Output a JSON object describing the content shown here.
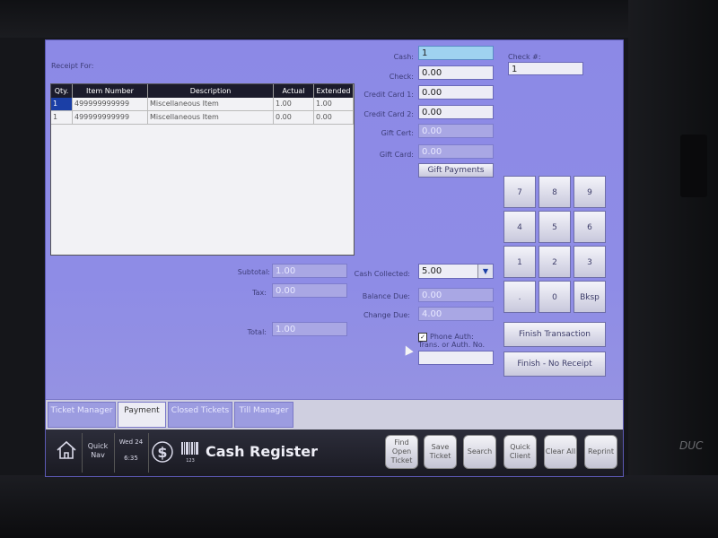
{
  "brand": "DUC",
  "receipt": {
    "label": "Receipt For:",
    "columns": [
      "Qty.",
      "Item Number",
      "Description",
      "Actual",
      "Extended"
    ],
    "rows": [
      [
        "1",
        "499999999999",
        "Miscellaneous Item",
        "1.00",
        "1.00"
      ],
      [
        "1",
        "499999999999",
        "Miscellaneous Item",
        "0.00",
        "0.00"
      ]
    ]
  },
  "totals": {
    "subtotal_label": "Subtotal:",
    "subtotal": "1.00",
    "tax_label": "Tax:",
    "tax": "0.00",
    "total_label": "Total:",
    "total": "1.00"
  },
  "payment": {
    "cash_label": "Cash:",
    "cash": "1",
    "check_label": "Check:",
    "check": "0.00",
    "credit1_label": "Credit Card 1:",
    "credit1": "0.00",
    "credit2_label": "Credit Card 2:",
    "credit2": "0.00",
    "gift_cert_label": "Gift Cert:",
    "gift_cert": "0.00",
    "gift_card_label": "Gift Card:",
    "gift_card": "0.00",
    "gift_payments_button": "Gift Payments",
    "check_num_label": "Check #:",
    "check_num": "1"
  },
  "summary": {
    "cash_collected_label": "Cash Collected:",
    "cash_collected": "5.00",
    "balance_due_label": "Balance Due:",
    "balance_due": "0.00",
    "change_due_label": "Change Due:",
    "change_due": "4.00",
    "phone_auth_label": "Phone Auth:",
    "phone_auth_sub": "Trans. or Auth. No.",
    "phone_auth_checked": "✓",
    "auth_no": ""
  },
  "keypad": [
    "7",
    "8",
    "9",
    "4",
    "5",
    "6",
    "1",
    "2",
    "3",
    ".",
    "0",
    "Bksp"
  ],
  "actions": {
    "finish": "Finish Transaction",
    "finish_no_receipt": "Finish - No Receipt"
  },
  "tabs": [
    "Ticket Manager",
    "Payment",
    "Closed Tickets",
    "Till Manager"
  ],
  "bar": {
    "quick_nav": "Quick Nav",
    "date": "Wed 24",
    "time": "6:35",
    "title": "Cash Register",
    "barcode_digits": "123",
    "buttons": [
      "Find Open Ticket",
      "Save Ticket",
      "Search",
      "Quick Client",
      "Clear All",
      "Reprint"
    ]
  }
}
